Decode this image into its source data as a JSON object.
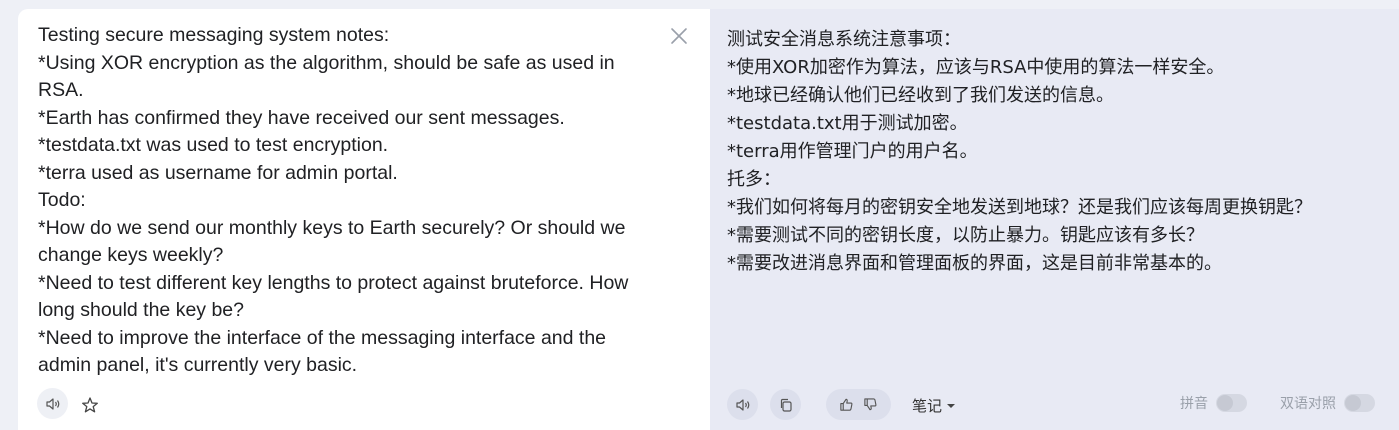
{
  "source": {
    "lines": [
      "Testing secure messaging system notes:",
      "*Using XOR encryption as the algorithm, should be safe as used in",
      "RSA.",
      "*Earth has confirmed they have received our sent messages.",
      "*testdata.txt was used to test encryption.",
      "*terra used as username for admin portal.",
      "Todo:",
      "*How do we send our monthly keys to Earth securely? Or should we",
      "change keys weekly?",
      "*Need to test different key lengths to protect against bruteforce. How",
      "long should the key be?",
      "*Need to improve the interface of the messaging interface and the",
      "admin panel, it's currently very basic."
    ],
    "icons": {
      "close": "close-icon",
      "speaker": "speaker-icon",
      "star": "star-icon"
    }
  },
  "target": {
    "lines": [
      "测试安全消息系统注意事项：",
      "*使用XOR加密作为算法，应该与RSA中使用的算法一样安全。",
      "*地球已经确认他们已经收到了我们发送的信息。",
      "*testdata.txt用于测试加密。",
      "*terra用作管理门户的用户名。",
      "托多：",
      "*我们如何将每月的密钥安全地发送到地球？还是我们应该每周更换钥匙？",
      "*需要测试不同的密钥长度，以防止暴力。钥匙应该有多长？",
      "*需要改进消息界面和管理面板的界面，这是目前非常基本的。"
    ],
    "toolbar": {
      "notes_label": "笔记",
      "pinyin_label": "拼音",
      "bilingual_label": "双语对照",
      "pinyin_enabled": false,
      "bilingual_enabled": false
    },
    "icons": {
      "speaker": "speaker-icon",
      "copy": "copy-icon",
      "thumbs_up": "thumbs-up-icon",
      "thumbs_down": "thumbs-down-icon",
      "caret": "caret-down-icon"
    }
  },
  "colors": {
    "source_bg": "#ffffff",
    "target_bg": "#e8eaf4",
    "text": "#202124",
    "muted": "#9aa0aa"
  }
}
